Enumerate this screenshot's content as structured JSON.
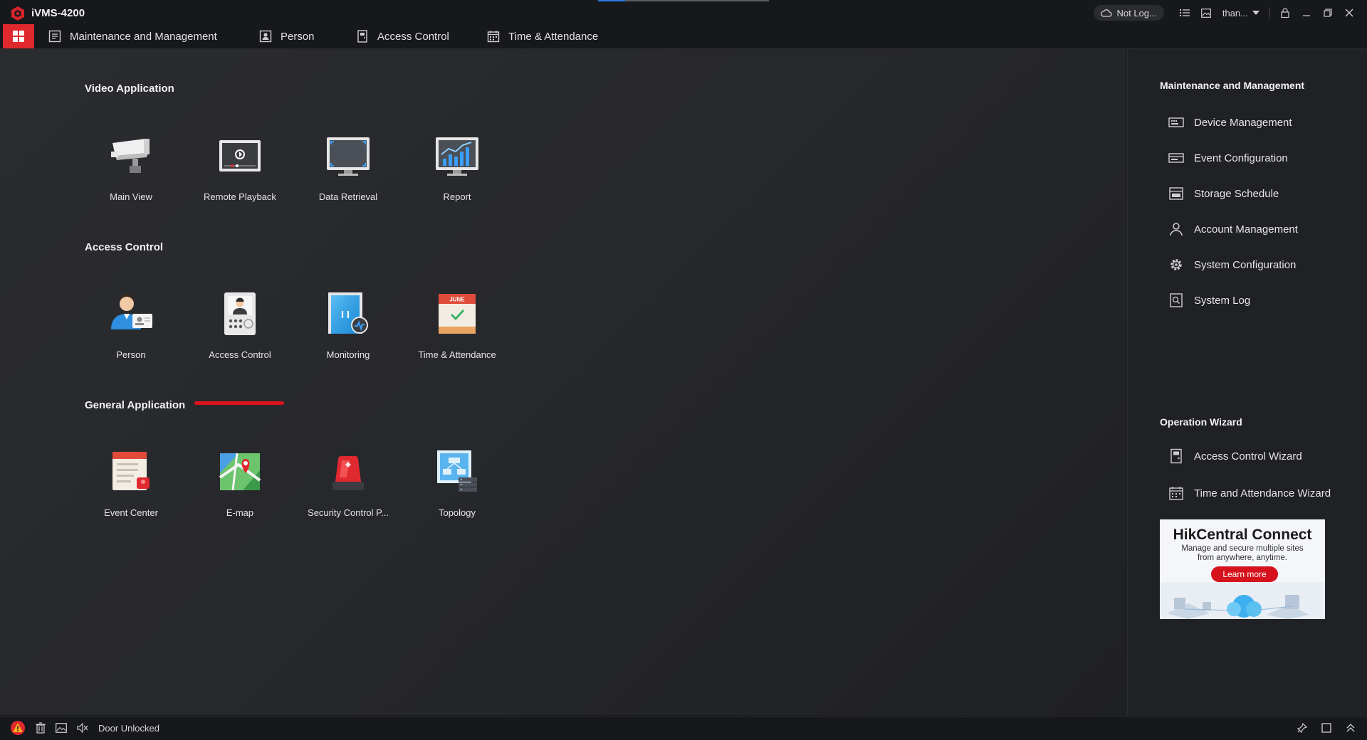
{
  "window": {
    "title": "iVMS-4200",
    "cloud_status": "Not Log...",
    "user": "than...",
    "load_progress_fraction": 0.16
  },
  "tabs": [
    {
      "label": "Maintenance and Management",
      "icon": "maintenance-icon"
    },
    {
      "label": "Person",
      "icon": "person-icon"
    },
    {
      "label": "Access Control",
      "icon": "access-control-icon"
    },
    {
      "label": "Time & Attendance",
      "icon": "calendar-icon"
    }
  ],
  "sections": {
    "video": {
      "title": "Video Application",
      "apps": [
        {
          "label": "Main View",
          "icon": "camera-icon"
        },
        {
          "label": "Remote Playback",
          "icon": "playback-icon"
        },
        {
          "label": "Data Retrieval",
          "icon": "monitor-icon"
        },
        {
          "label": "Report",
          "icon": "chart-icon"
        }
      ]
    },
    "access": {
      "title": "Access Control",
      "apps": [
        {
          "label": "Person",
          "icon": "person-card-icon"
        },
        {
          "label": "Access Control",
          "icon": "intercom-icon"
        },
        {
          "label": "Monitoring",
          "icon": "door-monitor-icon"
        },
        {
          "label": "Time & Attendance",
          "icon": "june-calendar-icon",
          "calendar_month": "JUNE"
        }
      ]
    },
    "general": {
      "title": "General Application",
      "apps": [
        {
          "label": "Event Center",
          "icon": "event-center-icon"
        },
        {
          "label": "E-map",
          "icon": "map-icon"
        },
        {
          "label": "Security Control P...",
          "icon": "alarm-light-icon"
        },
        {
          "label": "Topology",
          "icon": "topology-icon"
        }
      ]
    }
  },
  "right_panel": {
    "maintenance_title": "Maintenance and Management",
    "maintenance_items": [
      {
        "label": "Device Management",
        "icon": "device-icon"
      },
      {
        "label": "Event Configuration",
        "icon": "event-config-icon"
      },
      {
        "label": "Storage Schedule",
        "icon": "storage-icon"
      },
      {
        "label": "Account Management",
        "icon": "account-icon"
      },
      {
        "label": "System Configuration",
        "icon": "gear-icon"
      },
      {
        "label": "System Log",
        "icon": "log-icon"
      }
    ],
    "wizard_title": "Operation Wizard",
    "wizard_items": [
      {
        "label": "Access Control Wizard",
        "icon": "access-wizard-icon"
      },
      {
        "label": "Time and Attendance Wizard",
        "icon": "attendance-wizard-icon"
      }
    ],
    "banner": {
      "title": "HikCentral Connect",
      "subtitle_line1": "Manage and secure multiple sites",
      "subtitle_line2": "from anywhere, anytime.",
      "button": "Learn more"
    }
  },
  "status": {
    "message": "Door Unlocked"
  },
  "colors": {
    "accent_red": "#e0282f",
    "background": "#1c1d20",
    "link_blue": "#2a7be0"
  }
}
